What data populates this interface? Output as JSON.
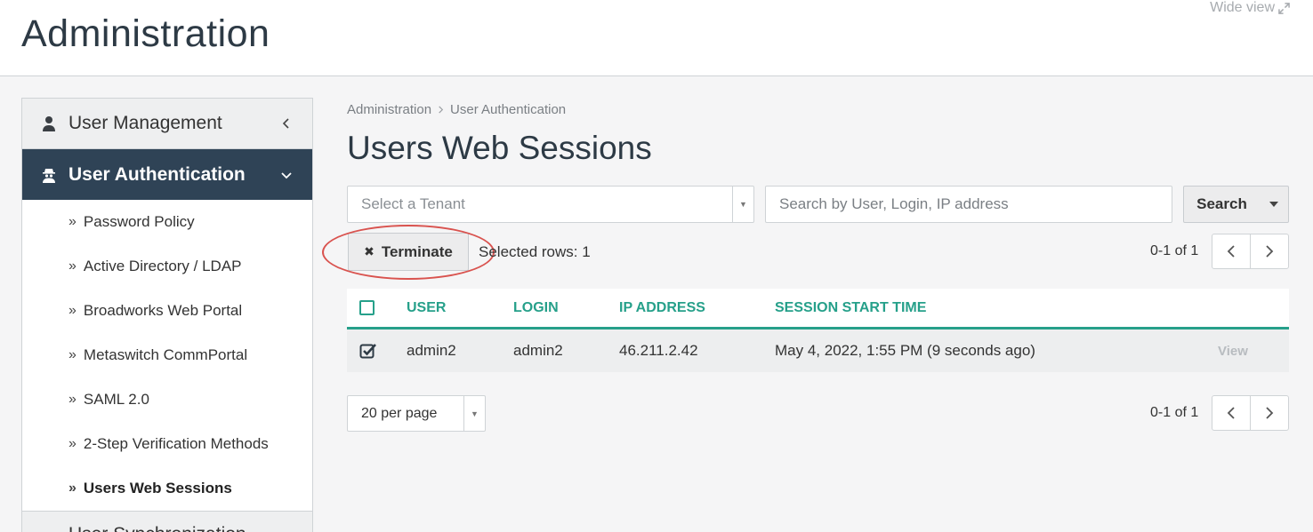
{
  "header": {
    "title": "Administration",
    "wide_view": "Wide view"
  },
  "sidebar": {
    "sections": [
      {
        "label": "User Management",
        "icon": "user-icon",
        "state": "collapsed"
      },
      {
        "label": "User Authentication",
        "icon": "user-secret-icon",
        "state": "expanded"
      }
    ],
    "items": [
      {
        "label": "Password Policy"
      },
      {
        "label": "Active Directory / LDAP"
      },
      {
        "label": "Broadworks Web Portal"
      },
      {
        "label": "Metaswitch CommPortal"
      },
      {
        "label": "SAML 2.0"
      },
      {
        "label": "2-Step Verification Methods"
      },
      {
        "label": "Users Web Sessions",
        "current": true
      }
    ],
    "next_section_partial": "User Synchronization"
  },
  "breadcrumb": [
    "Administration",
    "User Authentication"
  ],
  "page_title": "Users Web Sessions",
  "filters": {
    "tenant_placeholder": "Select a Tenant",
    "search_placeholder": "Search by User, Login, IP address",
    "search_button": "Search"
  },
  "actions": {
    "terminate_label": "Terminate",
    "selected_rows": "Selected rows: 1"
  },
  "pagination": {
    "range_text": "0-1 of 1",
    "per_page": "20 per page"
  },
  "table": {
    "columns": [
      "USER",
      "LOGIN",
      "IP ADDRESS",
      "SESSION START TIME"
    ],
    "rows": [
      {
        "user": "admin2",
        "login": "admin2",
        "ip": "46.211.2.42",
        "start": "May 4, 2022, 1:55 PM (9 seconds ago)",
        "action": "View",
        "selected": true
      }
    ]
  },
  "colors": {
    "accent": "#26a08a",
    "sidebar_active": "#2f4356",
    "annotation": "#d9534f"
  }
}
